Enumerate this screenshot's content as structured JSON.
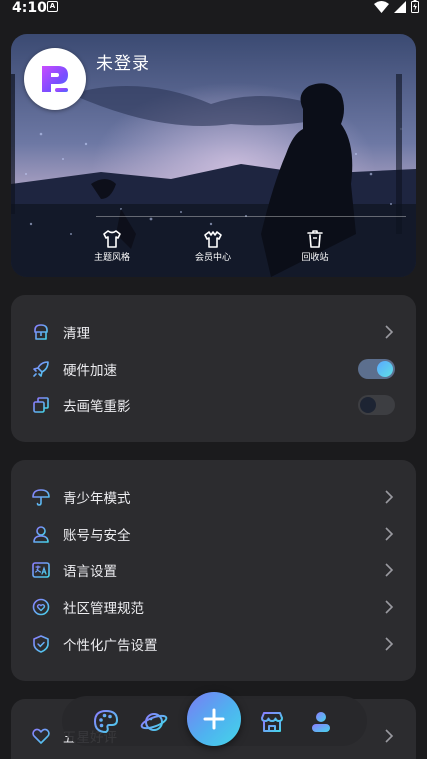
{
  "status_bar": {
    "time": "4:10",
    "notif_badge": "A"
  },
  "profile": {
    "username": "未登录"
  },
  "hero_actions": [
    {
      "label": "主题风格",
      "icon": "tshirt-icon"
    },
    {
      "label": "会员中心",
      "icon": "crown-shirt-icon"
    },
    {
      "label": "回收站",
      "icon": "trash-bin-icon"
    }
  ],
  "card1": {
    "cleanup": "清理",
    "hardware_accel": "硬件加速",
    "hardware_accel_on": true,
    "remove_brush_ghost": "去画笔重影",
    "remove_brush_ghost_on": false
  },
  "card2": {
    "youth_mode": "青少年模式",
    "account_security": "账号与安全",
    "language": "语言设置",
    "community_rules": "社区管理规范",
    "ad_settings": "个性化广告设置"
  },
  "card3": {
    "rate": "五星好评"
  },
  "bottom_nav": [
    "palette-icon",
    "planet-icon",
    "add-icon",
    "store-icon",
    "profile-icon"
  ],
  "colors": {
    "accent_start": "#7a7cf3",
    "accent_end": "#44d6e8",
    "card": "#2c2c2f",
    "background": "#1b1b1d"
  }
}
